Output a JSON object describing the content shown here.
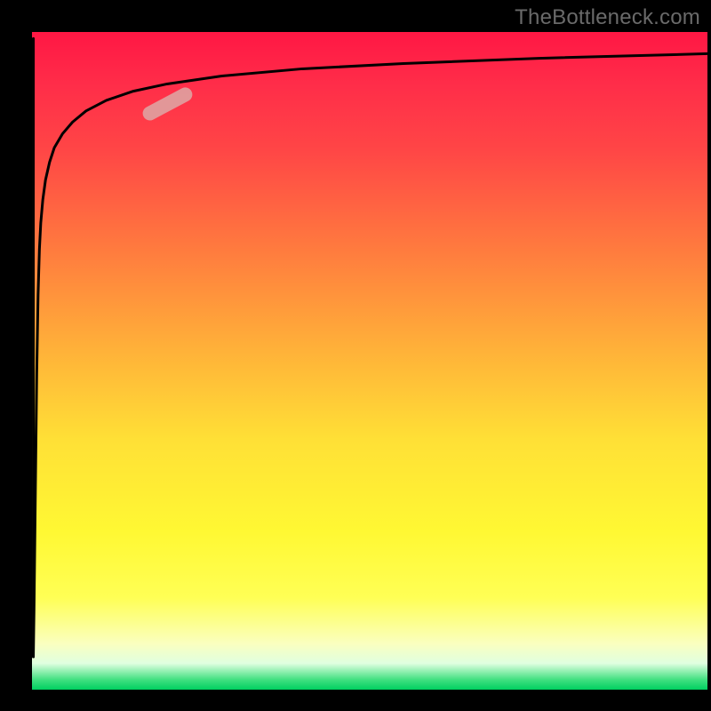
{
  "watermark": "TheBottleneck.com",
  "chart_data": {
    "type": "line",
    "title": "",
    "xlabel": "",
    "ylabel": "",
    "xlim": [
      0,
      100
    ],
    "ylim": [
      0,
      100
    ],
    "series": [
      {
        "name": "curve",
        "x": [
          0.2,
          0.3,
          0.5,
          0.7,
          0.9,
          1.1,
          1.3,
          1.6,
          2.0,
          2.6,
          3.3,
          4.5,
          6.0,
          8.0,
          11.0,
          15.0,
          20.0,
          28.0,
          40.0,
          55.0,
          75.0,
          100.0
        ],
        "values": [
          5.0,
          12.0,
          30.0,
          48.0,
          60.0,
          67.0,
          71.0,
          74.5,
          77.5,
          80.2,
          82.4,
          84.5,
          86.3,
          88.0,
          89.6,
          91.0,
          92.1,
          93.3,
          94.4,
          95.2,
          96.0,
          96.7
        ]
      }
    ],
    "marker": {
      "x_center": 20.0,
      "y_center": 89.0,
      "angle_deg": -28,
      "length": 8.0
    }
  }
}
